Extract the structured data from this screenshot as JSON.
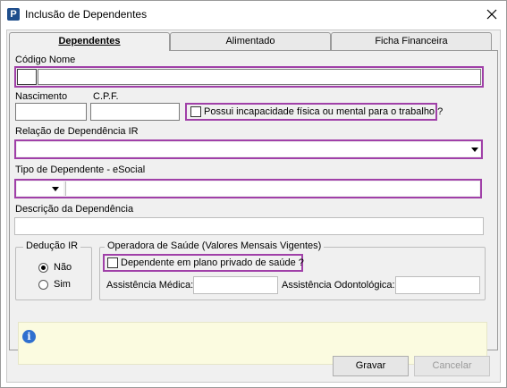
{
  "window": {
    "title": "Inclusão de Dependentes",
    "app_icon": "P"
  },
  "tabs": [
    {
      "label": "Dependentes",
      "active": true
    },
    {
      "label": "Alimentado",
      "active": false
    },
    {
      "label": "Ficha Financeira",
      "active": false
    }
  ],
  "form": {
    "codigo_nome_label": "Código Nome",
    "codigo_value": "",
    "nome_value": "",
    "nascimento_label": "Nascimento",
    "nascimento_value": "",
    "cpf_label": "C.P.F.",
    "cpf_value": "",
    "incapacidade_label": "Possui incapacidade física ou mental para o trabalho ?",
    "incapacidade_checked": false,
    "relacao_label": "Relação de Dependência IR",
    "relacao_value": "",
    "tipo_label": "Tipo de Dependente - eSocial",
    "tipo_code_value": "",
    "tipo_desc_value": "",
    "descricao_label": "Descrição da Dependência",
    "descricao_value": ""
  },
  "deducao": {
    "title": "Dedução IR",
    "options": [
      {
        "label": "Não",
        "selected": true
      },
      {
        "label": "Sim",
        "selected": false
      }
    ]
  },
  "operadora": {
    "title": "Operadora de Saúde (Valores Mensais Vigentes)",
    "plano_label": "Dependente em plano privado de saúde ?",
    "plano_checked": false,
    "medica_label": "Assistência Médica:",
    "medica_value": "",
    "odonto_label": "Assistência Odontológica:",
    "odonto_value": ""
  },
  "buttons": {
    "save": "Gravar",
    "cancel": "Cancelar"
  },
  "colors": {
    "highlight": "#a040a8",
    "info_bg": "#fbfbe0",
    "icon_blue": "#2f6fcf"
  }
}
